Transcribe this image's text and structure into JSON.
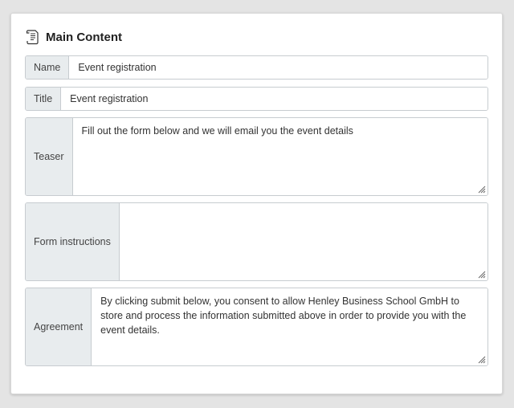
{
  "panel": {
    "title": "Main Content",
    "icon": "document-icon"
  },
  "fields": {
    "name": {
      "label": "Name",
      "value": "Event registration"
    },
    "title": {
      "label": "Title",
      "value": "Event registration"
    },
    "teaser": {
      "label": "Teaser",
      "value": "Fill out the form below and we will email you the event details"
    },
    "form_instructions": {
      "label": "Form instructions",
      "value": ""
    },
    "agreement": {
      "label": "Agreement",
      "value": "By clicking submit below, you consent to allow Henley Business School GmbH to store and process the information submitted above in order to provide you with the event details."
    }
  },
  "colors": {
    "background": "#e4e4e4",
    "panel": "#ffffff",
    "label_bg": "#e8ecee",
    "border": "#c7ccd0"
  }
}
